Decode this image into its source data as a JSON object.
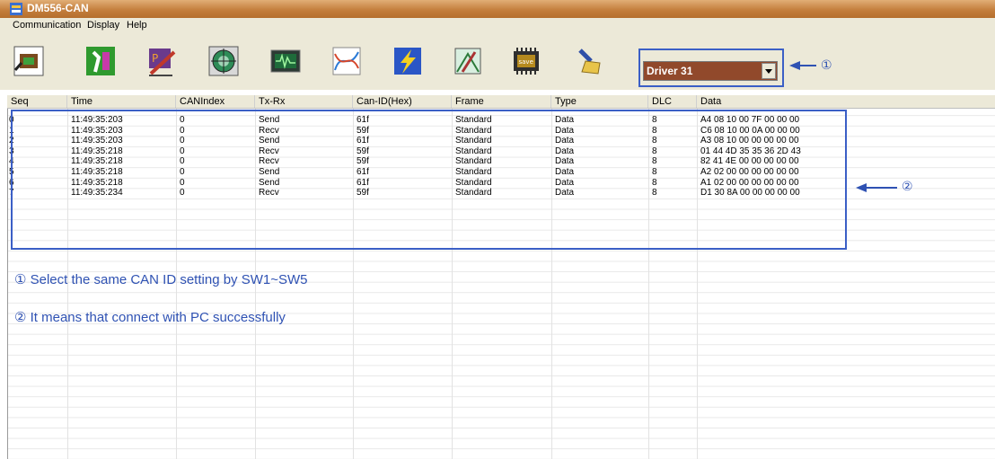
{
  "window": {
    "title": "DM556-CAN"
  },
  "menu": [
    "Communication",
    "Display",
    "Help"
  ],
  "toolbar_icons": [
    "connect-icon",
    "settings-icon",
    "edit-icon",
    "target-icon",
    "waveform-icon",
    "chart-icon",
    "lightning-icon",
    "import-icon",
    "save-chip-icon",
    "clear-icon"
  ],
  "save_chip_label": "save",
  "driver_select": {
    "value": "Driver 31"
  },
  "annotations": {
    "marker1": "①",
    "marker2": "②"
  },
  "table": {
    "columns": [
      "Seq",
      "Time",
      "CANIndex",
      "Tx-Rx",
      "Can-ID(Hex)",
      "Frame",
      "Type",
      "DLC",
      "Data"
    ],
    "rows": [
      [
        "0",
        "11:49:35:203",
        "0",
        "Send",
        "61f",
        "Standard",
        "Data",
        "8",
        "A4 08 10 00 7F 00 00 00"
      ],
      [
        "1",
        "11:49:35:203",
        "0",
        "Recv",
        "59f",
        "Standard",
        "Data",
        "8",
        "C6 08 10 00 0A 00 00 00"
      ],
      [
        "2",
        "11:49:35:203",
        "0",
        "Send",
        "61f",
        "Standard",
        "Data",
        "8",
        "A3 08 10 00 00 00 00 00"
      ],
      [
        "3",
        "11:49:35:218",
        "0",
        "Recv",
        "59f",
        "Standard",
        "Data",
        "8",
        "01 44 4D 35 35 36 2D 43"
      ],
      [
        "4",
        "11:49:35:218",
        "0",
        "Recv",
        "59f",
        "Standard",
        "Data",
        "8",
        "82 41 4E 00 00 00 00 00"
      ],
      [
        "5",
        "11:49:35:218",
        "0",
        "Send",
        "61f",
        "Standard",
        "Data",
        "8",
        "A2 02 00 00 00 00 00 00"
      ],
      [
        "6",
        "11:49:35:218",
        "0",
        "Send",
        "61f",
        "Standard",
        "Data",
        "8",
        "A1 02 00 00 00 00 00 00"
      ],
      [
        "7",
        "11:49:35:234",
        "0",
        "Recv",
        "59f",
        "Standard",
        "Data",
        "8",
        "D1 30 8A 00 00 00 00 00"
      ]
    ]
  },
  "notes": [
    "① Select the same CAN ID setting by SW1~SW5",
    "② It means that connect with PC successfully"
  ],
  "colors": {
    "titlebar": "#c47f3d",
    "annotation": "#3b5fc6",
    "select_bg": "#91492b"
  }
}
